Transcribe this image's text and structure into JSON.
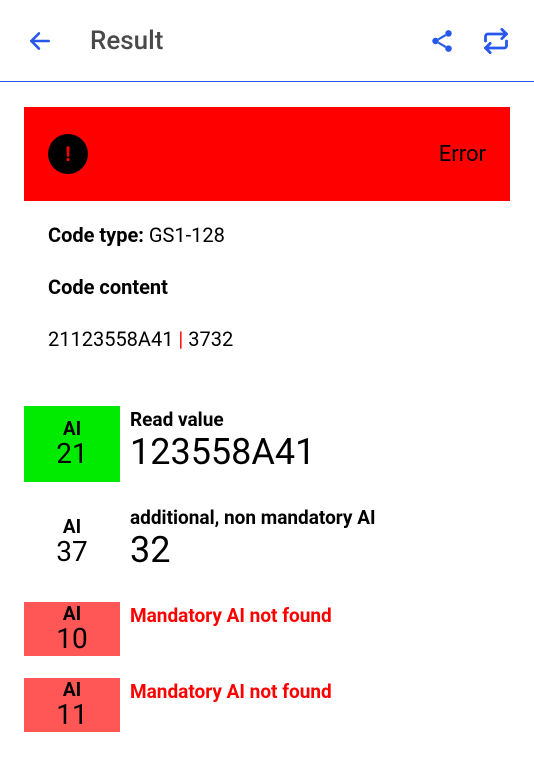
{
  "header": {
    "title": "Result"
  },
  "error": {
    "label": "Error"
  },
  "code": {
    "type_label": "Code type: ",
    "type_value": "GS1-128",
    "content_label": "Code content",
    "content_part1": "21123558A41 ",
    "content_sep": "|",
    "content_part2": " 3732"
  },
  "ai_rows": [
    {
      "box_class": "green",
      "ai_label": "AI",
      "ai_number": "21",
      "detail_label": "Read value",
      "detail_value": "123558A41",
      "label_red": false,
      "short": false
    },
    {
      "box_class": "white",
      "ai_label": "AI",
      "ai_number": "37",
      "detail_label": "additional, non mandatory AI",
      "detail_value": "32",
      "label_red": false,
      "short": false
    },
    {
      "box_class": "red",
      "ai_label": "AI",
      "ai_number": "10",
      "detail_label": "Mandatory AI not found",
      "detail_value": "",
      "label_red": true,
      "short": true
    },
    {
      "box_class": "red",
      "ai_label": "AI",
      "ai_number": "11",
      "detail_label": "Mandatory AI not found",
      "detail_value": "",
      "label_red": true,
      "short": true
    }
  ],
  "colors": {
    "accent": "#2857ee",
    "error_bg": "#ff0000",
    "ai_green": "#00eb00",
    "ai_red": "#ff5656"
  }
}
